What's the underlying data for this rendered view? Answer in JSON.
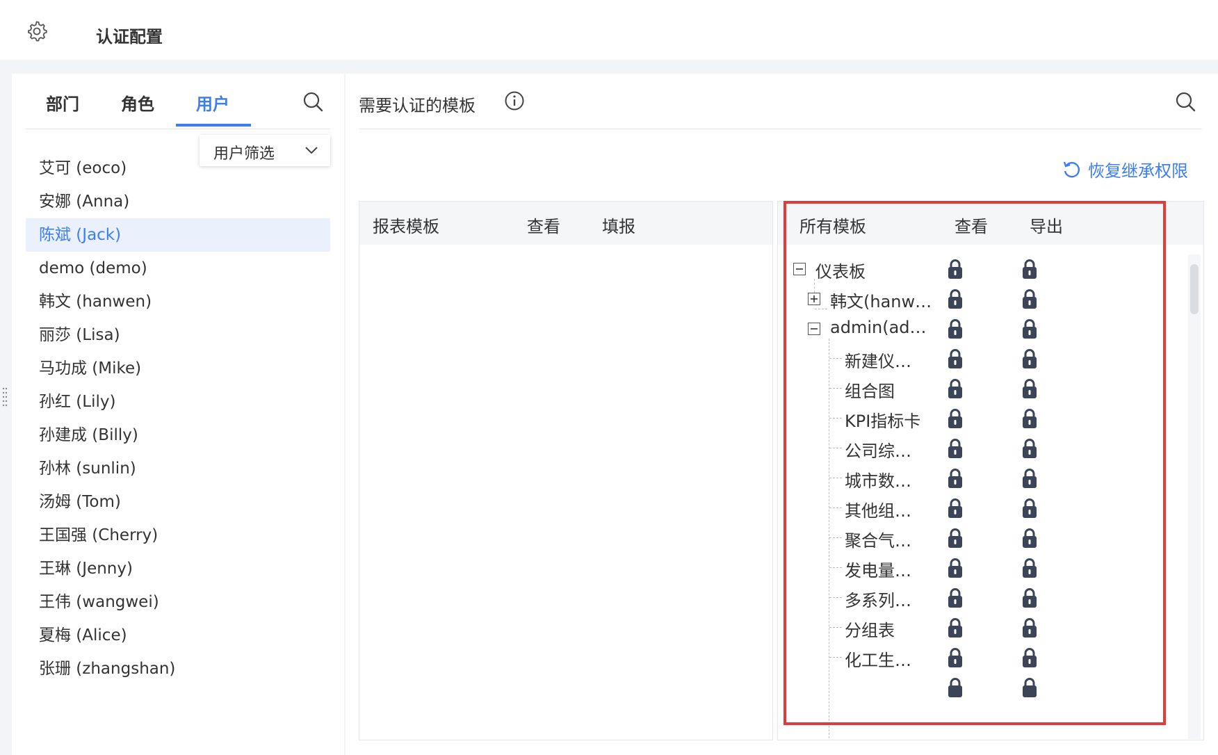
{
  "header": {
    "title": "认证配置"
  },
  "left": {
    "tabs": [
      "部门",
      "角色",
      "用户"
    ],
    "filter_label": "用户筛选",
    "users": [
      {
        "label": "艾可 (eoco)",
        "selected": false
      },
      {
        "label": "安娜 (Anna)",
        "selected": false
      },
      {
        "label": "陈斌 (Jack)",
        "selected": true
      },
      {
        "label": "demo (demo)",
        "selected": false
      },
      {
        "label": "韩文 (hanwen)",
        "selected": false
      },
      {
        "label": "丽莎 (Lisa)",
        "selected": false
      },
      {
        "label": "马功成 (Mike)",
        "selected": false
      },
      {
        "label": "孙红 (Lily)",
        "selected": false
      },
      {
        "label": "孙建成 (Billy)",
        "selected": false
      },
      {
        "label": "孙林 (sunlin)",
        "selected": false
      },
      {
        "label": "汤姆 (Tom)",
        "selected": false
      },
      {
        "label": "王国强 (Cherry)",
        "selected": false
      },
      {
        "label": "王琳 (Jenny)",
        "selected": false
      },
      {
        "label": "王伟 (wangwei)",
        "selected": false
      },
      {
        "label": "夏梅 (Alice)",
        "selected": false
      },
      {
        "label": "张珊 (zhangshan)",
        "selected": false
      }
    ]
  },
  "right": {
    "header": "需要认证的模板",
    "restore_label": "恢复继承权限",
    "report_panel": {
      "col1": "报表模板",
      "col2": "查看",
      "col3": "填报"
    },
    "all_panel": {
      "col1": "所有模板",
      "col2": "查看",
      "col3": "导出"
    },
    "tree": [
      {
        "label": "仪表板",
        "level": 0,
        "expander": "minus"
      },
      {
        "label": "韩文(hanw…",
        "level": 1,
        "expander": "plus"
      },
      {
        "label": "admin(ad…",
        "level": 1,
        "expander": "minus"
      },
      {
        "label": "新建仪…",
        "level": 2
      },
      {
        "label": "组合图",
        "level": 2
      },
      {
        "label": "KPI指标卡",
        "level": 2
      },
      {
        "label": "公司综…",
        "level": 2
      },
      {
        "label": "城市数…",
        "level": 2
      },
      {
        "label": "其他组…",
        "level": 2
      },
      {
        "label": "聚合气…",
        "level": 2
      },
      {
        "label": "发电量…",
        "level": 2
      },
      {
        "label": "多系列…",
        "level": 2
      },
      {
        "label": "分组表",
        "level": 2
      },
      {
        "label": "化工生…",
        "level": 2
      }
    ]
  },
  "colors": {
    "accent": "#3d7ef2",
    "highlight_box": "#e03c3c",
    "lock": "#3c4457"
  },
  "icons": {
    "settings": "gear-icon",
    "search": "search-icon",
    "info": "info-icon",
    "restore": "undo-icon",
    "lock": "lock-icon",
    "expand": "plus-square-icon",
    "collapse": "minus-square-icon"
  }
}
